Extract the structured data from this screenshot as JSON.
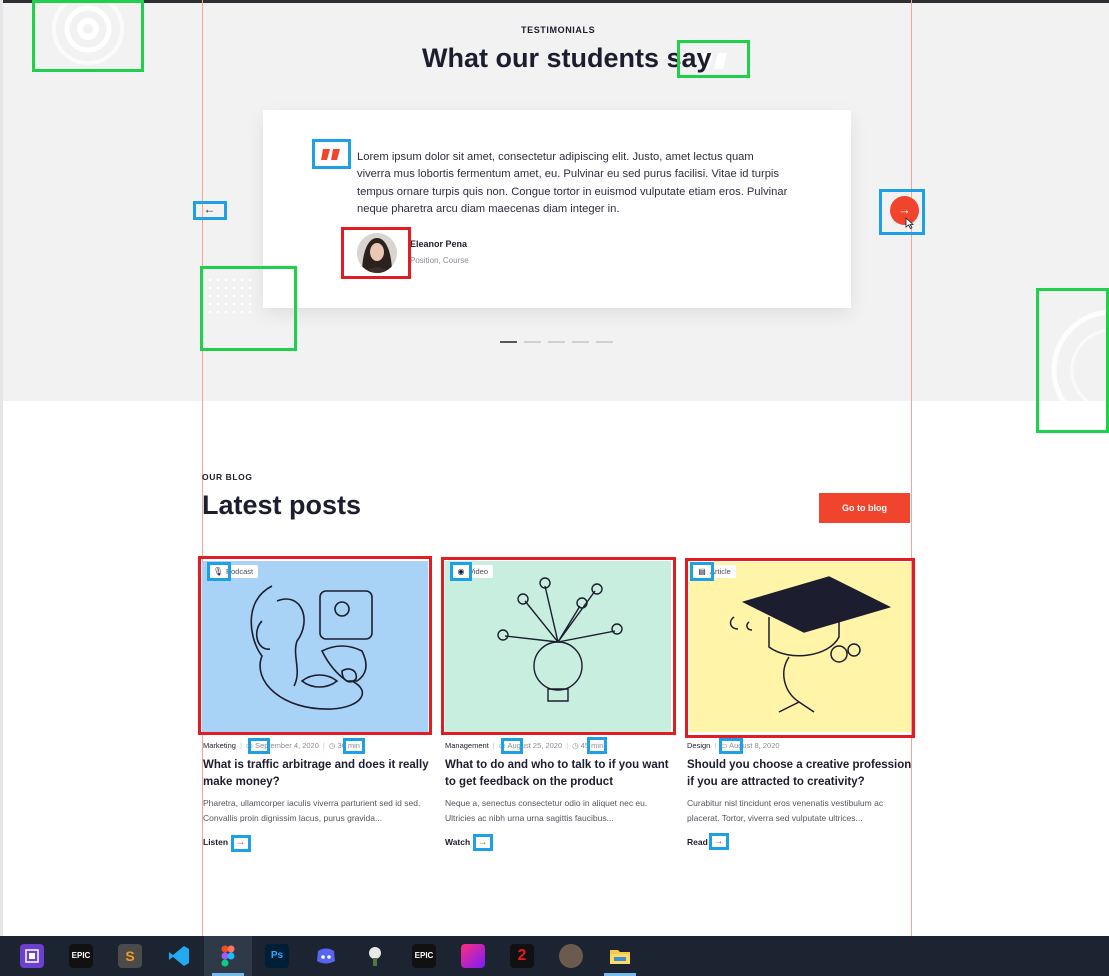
{
  "testimonials": {
    "eyebrow": "TESTIMONIALS",
    "title": "What our students say",
    "quote": "Lorem ipsum dolor sit amet, consectetur adipiscing elit. Justo, amet lectus quam viverra mus lobortis fermentum amet, eu. Pulvinar eu sed purus facilisi. Vitae id turpis tempus ornare turpis quis non. Congue tortor in euismod vulputate etiam eros. Pulvinar neque pharetra arcu diam maecenas diam integer in.",
    "author_name": "Eleanor Pena",
    "author_role": "Position, Course",
    "prev_icon": "←",
    "next_icon": "→",
    "slide_count": 5,
    "active_slide": 1
  },
  "blog": {
    "eyebrow": "OUR BLOG",
    "title": "Latest posts",
    "button_label": "Go to blog",
    "posts": [
      {
        "type": "Podcast",
        "type_icon": "microphone-icon",
        "category": "Marketing",
        "date": "September 4, 2020",
        "duration": "36 min",
        "title": "What is traffic arbitrage and does it really make money?",
        "excerpt": "Pharetra, ullamcorper iaculis viverra parturient sed id sed. Convallis proin dignissim lacus, purus gravida...",
        "action": "Listen",
        "image_bg": "#a9d3f6"
      },
      {
        "type": "Video",
        "type_icon": "play-circle-icon",
        "category": "Management",
        "date": "August 25, 2020",
        "duration": "45 min",
        "title": "What to do and who to talk to if you want to get feedback on the product",
        "excerpt": "Neque a, senectus consectetur odio in aliquet nec eu. Ultricies ac nibh urna urna sagittis faucibus...",
        "action": "Watch",
        "image_bg": "#c8eee0"
      },
      {
        "type": "Article",
        "type_icon": "document-icon",
        "category": "Design",
        "date": "August 8, 2020",
        "duration": "",
        "title": "Should you choose a creative profession if you are attracted to creativity?",
        "excerpt": "Curabitur nisl tincidunt eros venenatis vestibulum ac placerat. Tortor, viverra sed vulputate ultrices...",
        "action": "Read",
        "image_bg": "#fff4a8"
      }
    ]
  },
  "colors": {
    "accent": "#f0452c",
    "heading": "#1c1d2e",
    "section_bg": "#f2f2f3",
    "annotation_green": "#1fd14a",
    "annotation_blue": "#1ea0e6",
    "annotation_red": "#e31b23"
  },
  "taskbar": {
    "items": [
      {
        "name": "cpu-z-icon",
        "label": ""
      },
      {
        "name": "epic-games-icon",
        "label": "EPIC"
      },
      {
        "name": "sublime-text-icon",
        "label": "S"
      },
      {
        "name": "vscode-icon",
        "label": ""
      },
      {
        "name": "figma-icon",
        "label": "",
        "active": true
      },
      {
        "name": "photoshop-icon",
        "label": "Ps"
      },
      {
        "name": "discord-icon",
        "label": ""
      },
      {
        "name": "game-app-icon",
        "label": ""
      },
      {
        "name": "epic-games-icon-2",
        "label": "EPIC"
      },
      {
        "name": "forza-icon",
        "label": ""
      },
      {
        "name": "game-2-icon",
        "label": "2"
      },
      {
        "name": "avatar-app-icon",
        "label": ""
      },
      {
        "name": "file-explorer-icon",
        "label": ""
      }
    ]
  }
}
